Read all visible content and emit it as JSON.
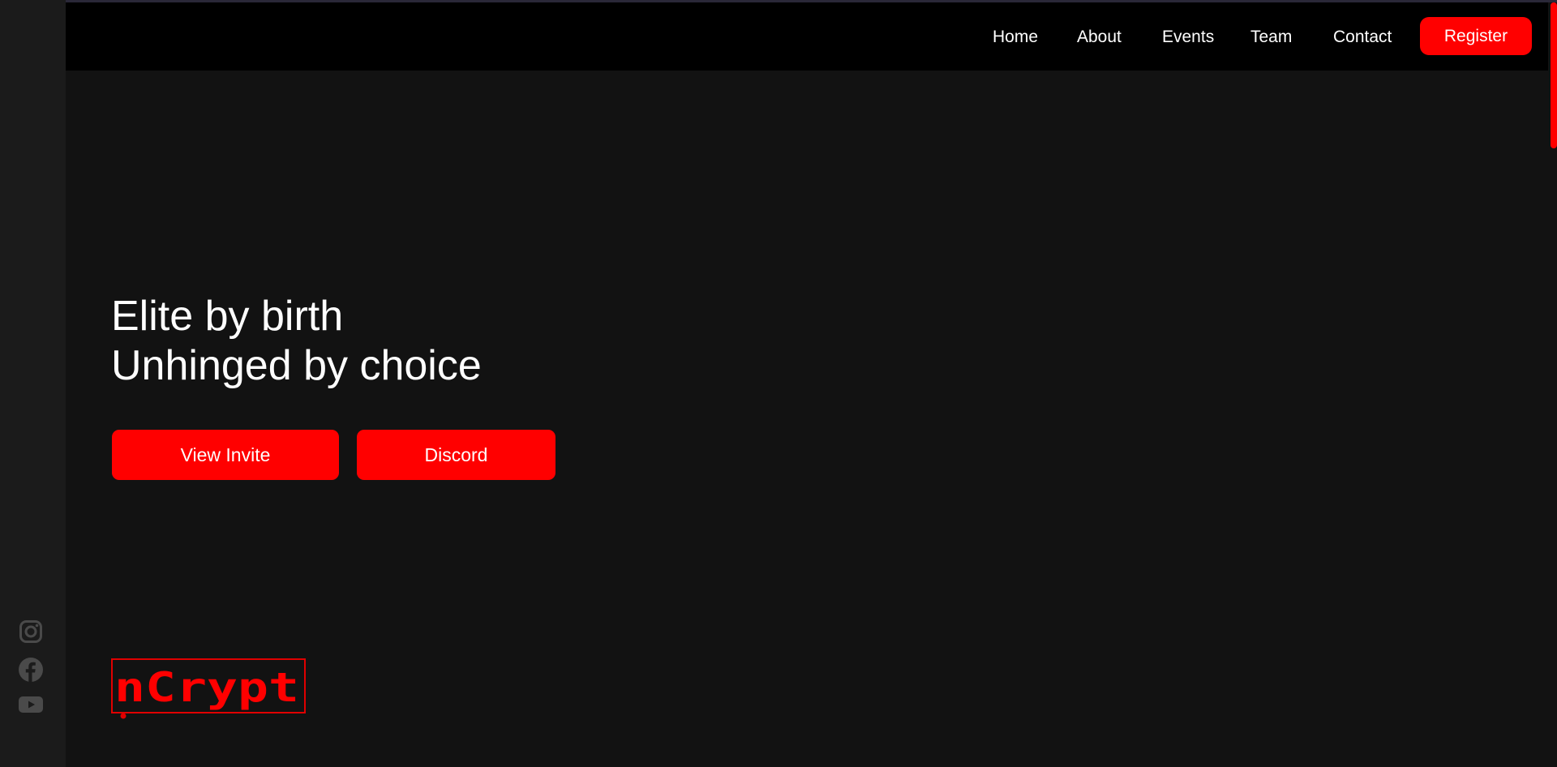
{
  "nav": {
    "links": [
      "Home",
      "About",
      "Events",
      "Team",
      "Contact"
    ],
    "register_label": "Register"
  },
  "hero": {
    "line1": "Elite by birth",
    "line2": "Unhinged by choice",
    "buttons": [
      "View Invite",
      "Discord"
    ]
  },
  "logo": {
    "text": "nCrypt",
    "icon": "ncrypt-logo"
  },
  "social": {
    "icons": [
      "instagram-icon",
      "facebook-icon",
      "youtube-icon"
    ]
  },
  "colors": {
    "accent": "#ff0000",
    "navbar_bg": "#000000",
    "page_bg": "#121212",
    "rail_bg": "#1b1b1b",
    "icon_gray": "#4a4a4a"
  }
}
